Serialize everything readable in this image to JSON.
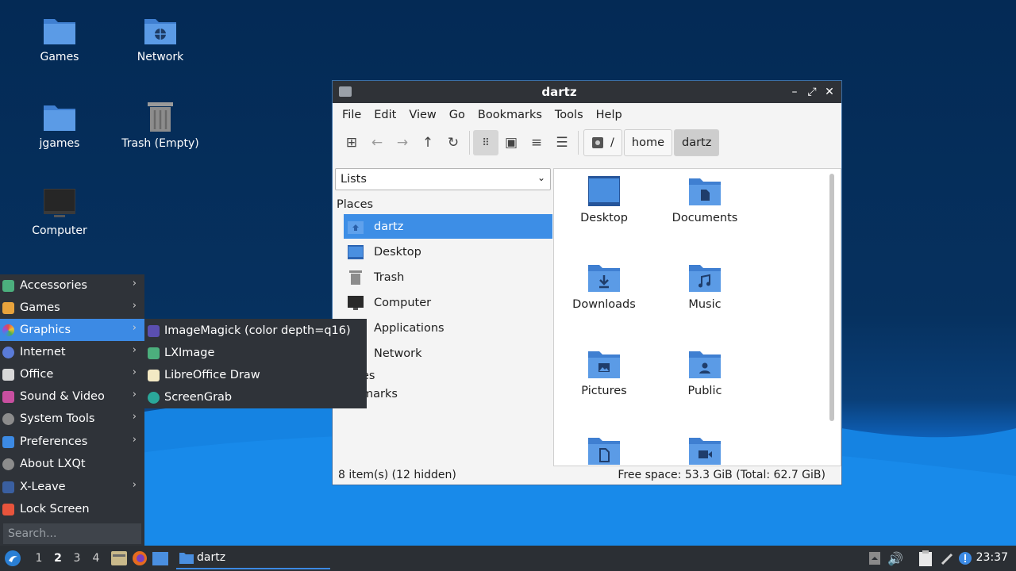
{
  "desktop": {
    "icons": [
      {
        "label": "Games"
      },
      {
        "label": "Network"
      },
      {
        "label": "jgames"
      },
      {
        "label": "Trash (Empty)"
      },
      {
        "label": "Computer"
      }
    ]
  },
  "window": {
    "title": "dartz",
    "controls": {
      "minimize": "–",
      "maximize": "⤢",
      "close": "✕"
    },
    "menu": [
      "File",
      "Edit",
      "View",
      "Go",
      "Bookmarks",
      "Tools",
      "Help"
    ],
    "breadcrumb": {
      "root": "/",
      "items": [
        "home",
        "dartz"
      ]
    },
    "side_panel": {
      "selector": "Lists",
      "places_label": "Places",
      "places": [
        "dartz",
        "Desktop",
        "Trash",
        "Computer",
        "Applications",
        "Network"
      ],
      "partial_labels": [
        "es",
        "marks"
      ]
    },
    "files": [
      {
        "name": "Desktop"
      },
      {
        "name": "Documents"
      },
      {
        "name": "Downloads"
      },
      {
        "name": "Music"
      },
      {
        "name": "Pictures"
      },
      {
        "name": "Public"
      },
      {
        "name": ""
      },
      {
        "name": ""
      }
    ],
    "status": {
      "left": "8 item(s) (12 hidden)",
      "right": "Free space: 53.3 GiB (Total: 62.7 GiB)"
    }
  },
  "start_menu": {
    "items": [
      "Accessories",
      "Games",
      "Graphics",
      "Internet",
      "Office",
      "Sound & Video",
      "System Tools",
      "Preferences",
      "About LXQt",
      "X-Leave",
      "Lock Screen"
    ],
    "search_placeholder": "Search...",
    "submenu": [
      "ImageMagick (color depth=q16)",
      "LXImage",
      "LibreOffice Draw",
      "ScreenGrab"
    ]
  },
  "taskbar": {
    "desktops": [
      "1",
      "2",
      "3",
      "4"
    ],
    "task_label": "dartz",
    "clock": "23:37"
  },
  "colors": {
    "accent": "#3d8ee6",
    "panel": "#2f3339",
    "folder": "#4a8fe0"
  }
}
